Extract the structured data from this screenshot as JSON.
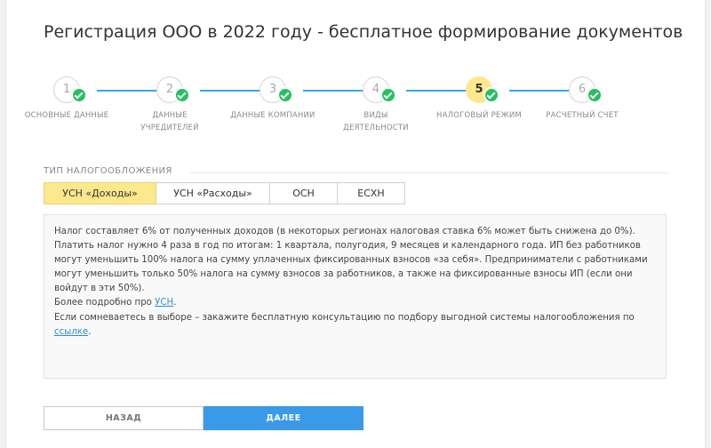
{
  "page": {
    "title": "Регистрация ООО в 2022 году - бесплатное формирование документов"
  },
  "steps": [
    {
      "number": "1",
      "label": "Основные данные",
      "completed": true,
      "active": false
    },
    {
      "number": "2",
      "label": "Данные учредителей",
      "completed": true,
      "active": false
    },
    {
      "number": "3",
      "label": "Данные компании",
      "completed": true,
      "active": false
    },
    {
      "number": "4",
      "label": "Виды деятельности",
      "completed": true,
      "active": false
    },
    {
      "number": "5",
      "label": "Налоговый режим",
      "completed": true,
      "active": true
    },
    {
      "number": "6",
      "label": "Расчетный счет",
      "completed": true,
      "active": false
    }
  ],
  "tax": {
    "section_label": "ТИП НАЛОГООБЛОЖЕНИЯ",
    "tabs": [
      {
        "label": "УСН «Доходы»",
        "active": true
      },
      {
        "label": "УСН «Расходы»",
        "active": false
      },
      {
        "label": "ОСН",
        "active": false
      },
      {
        "label": "ЕСХН",
        "active": false
      }
    ]
  },
  "info": {
    "p1": "Налог составляет 6% от полученных доходов (в некоторых регионах налоговая ставка 6% может быть снижена до 0%).",
    "p2": "Платить налог нужно 4 раза в год по итогам: 1 квартала, полугодия, 9 месяцев и календарного года. ИП без работников могут уменьшить 100% налога на сумму уплаченных фиксированных взносов «за себя». Предприниматели с работниками могут уменьшить только 50% налога на сумму взносов за работников, а также на фиксированные взносы ИП (если они войдут в эти 50%).",
    "p3_prefix": "Более подробно про ",
    "p3_link": "УСН",
    "p3_suffix": ".",
    "p4_prefix": "Если сомневаетесь в выборе – закажите бесплатную консультацию по подбору выгодной системы налогообложения по ",
    "p4_link": "ссылке",
    "p4_suffix": "."
  },
  "buttons": {
    "back": "НАЗАД",
    "next": "ДАЛЕЕ"
  },
  "colors": {
    "accent_blue": "#34a8ea",
    "active_yellow": "#fde88d",
    "check_green": "#25c15e",
    "link_blue": "#2d8bd6",
    "button_blue": "#3a9ae8"
  }
}
